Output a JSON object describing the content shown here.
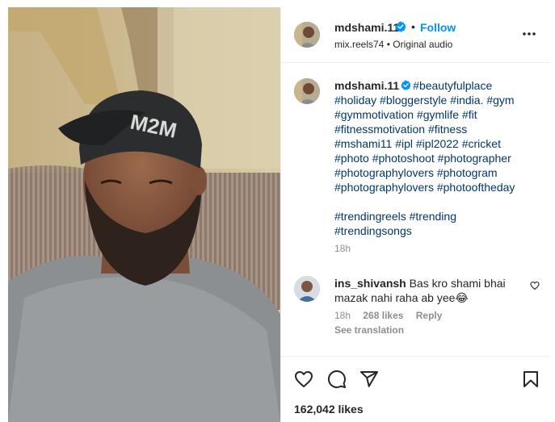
{
  "post": {
    "username": "mdshami.11",
    "verified": true,
    "follow_label": "Follow",
    "dot": "•",
    "audio": {
      "account": "mix.reels74",
      "separator": "•",
      "label": "Original audio"
    }
  },
  "caption": {
    "username": "mdshami.11",
    "lines": [
      "#beautyfulplace",
      "#holiday #bloggerstyle #india. #gym",
      "#gymmotivation #gymlife #fit",
      "#fitnessmotivation #fitness",
      "#mshami11 #ipl #ipl2022 #cricket",
      "#photo #photoshoot #photographer",
      "#photographylovers #photogram",
      "#photographylovers #photooftheday",
      "",
      "#trendingreels #trending",
      "#trendingsongs"
    ],
    "time": "18h"
  },
  "comment": {
    "username": "ins_shivansh",
    "text": "Bas kro shami bhai mazak nahi raha ab yee😂",
    "time": "18h",
    "likes": "268 likes",
    "reply_label": "Reply",
    "see_translation": "See translation"
  },
  "actions": {
    "icons": [
      "heart-icon",
      "comment-icon",
      "share-icon",
      "bookmark-icon"
    ]
  },
  "likes": "162,042 likes",
  "colors": {
    "accent": "#0095f6",
    "verified": "#0095f6",
    "hashtag": "#00376b",
    "muted": "#8e8e8e",
    "text": "#262626"
  }
}
